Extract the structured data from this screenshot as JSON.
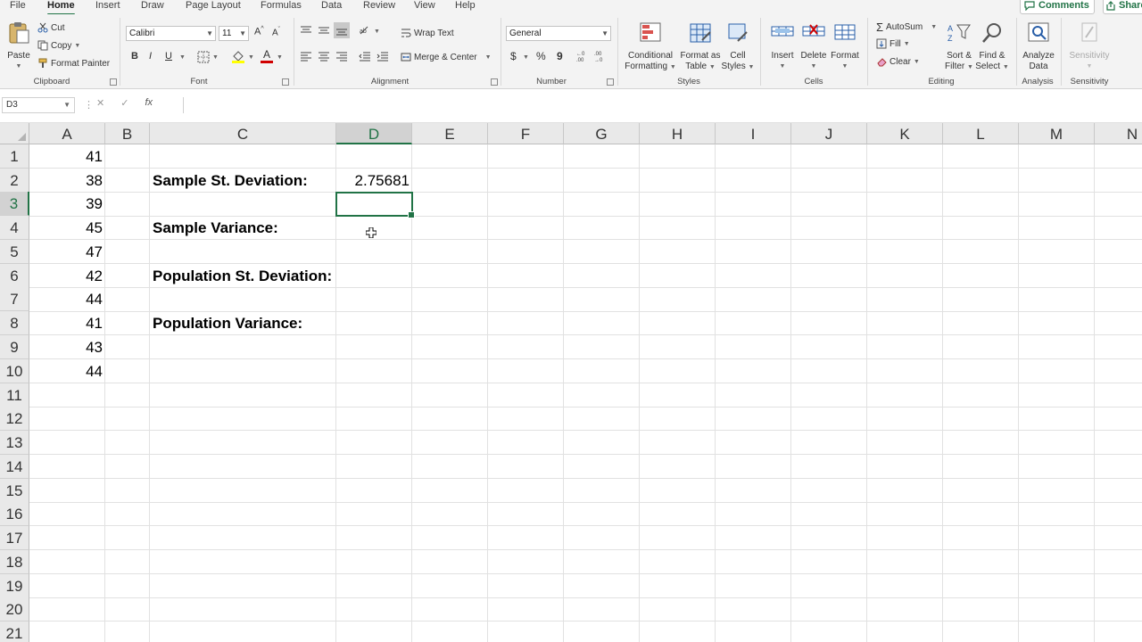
{
  "menu_tabs": [
    "File",
    "Home",
    "Insert",
    "Draw",
    "Page Layout",
    "Formulas",
    "Data",
    "Review",
    "View",
    "Help"
  ],
  "active_tab": "Home",
  "comments_label": "Comments",
  "share_label": "Share",
  "ribbon": {
    "clipboard": {
      "paste": "Paste",
      "cut": "Cut",
      "copy": "Copy",
      "format_painter": "Format Painter",
      "group": "Clipboard"
    },
    "font": {
      "font_name": "Calibri",
      "font_size": "11",
      "bold": "B",
      "italic": "I",
      "underline": "U",
      "group": "Font"
    },
    "alignment": {
      "wrap_text": "Wrap Text",
      "merge_center": "Merge & Center",
      "group": "Alignment"
    },
    "number": {
      "format": "General",
      "currency": "$",
      "percent": "%",
      "comma": "9",
      "group": "Number"
    },
    "styles": {
      "conditional": [
        "Conditional",
        "Formatting"
      ],
      "format_table": [
        "Format as",
        "Table"
      ],
      "cell_styles": [
        "Cell",
        "Styles"
      ],
      "group": "Styles"
    },
    "cells": {
      "insert": "Insert",
      "delete": "Delete",
      "format": "Format",
      "group": "Cells"
    },
    "editing": {
      "autosum": "AutoSum",
      "fill": "Fill",
      "clear": "Clear",
      "sort_filter": [
        "Sort &",
        "Filter"
      ],
      "find_select": [
        "Find &",
        "Select"
      ],
      "group": "Editing"
    },
    "analysis": {
      "analyze": [
        "Analyze",
        "Data"
      ],
      "group": "Analysis"
    },
    "sensitivity": {
      "label": "Sensitivity",
      "group": "Sensitivity"
    }
  },
  "formula_bar": {
    "name_box": "D3",
    "cancel": "✕",
    "enter": "✓",
    "fx": "fx",
    "formula": ""
  },
  "columns": [
    "A",
    "B",
    "C",
    "D",
    "E",
    "F",
    "G",
    "H",
    "I",
    "J",
    "K",
    "L",
    "M",
    "N"
  ],
  "selected_column": "D",
  "rows": [
    "1",
    "2",
    "3",
    "4",
    "5",
    "6",
    "7",
    "8",
    "9",
    "10",
    "11",
    "12",
    "13",
    "14",
    "15",
    "16",
    "17",
    "18",
    "19",
    "20",
    "21"
  ],
  "selected_row": "3",
  "column_a_values": [
    "41",
    "38",
    "39",
    "45",
    "47",
    "42",
    "44",
    "41",
    "43",
    "44"
  ],
  "labels": {
    "c2": "Sample St. Deviation:",
    "c4": "Sample Variance:",
    "c6": "Population St. Deviation:",
    "c8": "Population Variance:"
  },
  "d2_value": "2.75681",
  "colors": {
    "accent": "#217346",
    "ribbon_bg": "#f3f3f3",
    "header_bg": "#e9e9e9",
    "selected_header_bg": "#d2d2d2"
  }
}
